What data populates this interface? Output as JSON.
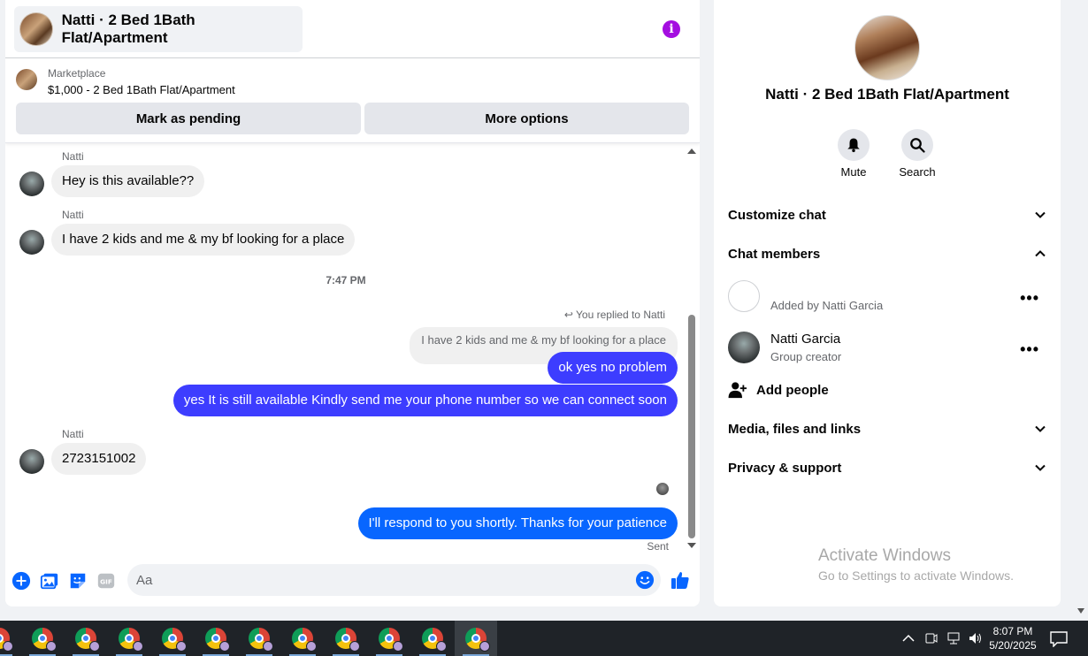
{
  "chat": {
    "title": "Natti · 2 Bed 1Bath Flat/Apartment",
    "marketplace": {
      "label": "Marketplace",
      "listing": "$1,000 - 2 Bed 1Bath Flat/Apartment",
      "mark_pending": "Mark as pending",
      "more_options": "More options"
    },
    "messages": {
      "m1_sender": "Natti",
      "m1_text": "Hey is this available??",
      "m2_sender": "Natti",
      "m2_text": "I have 2 kids and me & my bf looking for a place",
      "time_separator": "7:47 PM",
      "reply_note": "You replied to Natti",
      "quoted_text": "I have 2 kids and me & my bf looking for a place",
      "out1": "ok yes no problem",
      "out2": "yes It is still available Kindly send me your phone number so we can connect soon",
      "m3_sender": "Natti",
      "m3_text": "2723151002",
      "out3": "I'll respond to you shortly. Thanks for your patience",
      "status": "Sent"
    },
    "composer": {
      "placeholder": "Aa"
    }
  },
  "info": {
    "title": "Natti · 2 Bed 1Bath Flat/Apartment",
    "mute_label": "Mute",
    "search_label": "Search",
    "customize_chat": "Customize chat",
    "chat_members": "Chat members",
    "member1_sub": "Added by Natti Garcia",
    "member2_name": "Natti Garcia",
    "member2_sub": "Group creator",
    "add_people": "Add people",
    "media_files": "Media, files and links",
    "privacy_support": "Privacy & support",
    "activate_title": "Activate Windows",
    "activate_sub": "Go to Settings to activate Windows."
  },
  "taskbar": {
    "time": "8:07 PM",
    "date": "5/20/2025",
    "apps": [
      "chrome",
      "chrome",
      "chrome",
      "chrome",
      "chrome",
      "chrome",
      "chrome",
      "chrome",
      "chrome",
      "chrome",
      "chrome",
      "chrome"
    ]
  },
  "colors": {
    "accent": "#0866ff",
    "outgoing_bubble": "#3d3dff",
    "info_icon": "#a40ee0"
  }
}
